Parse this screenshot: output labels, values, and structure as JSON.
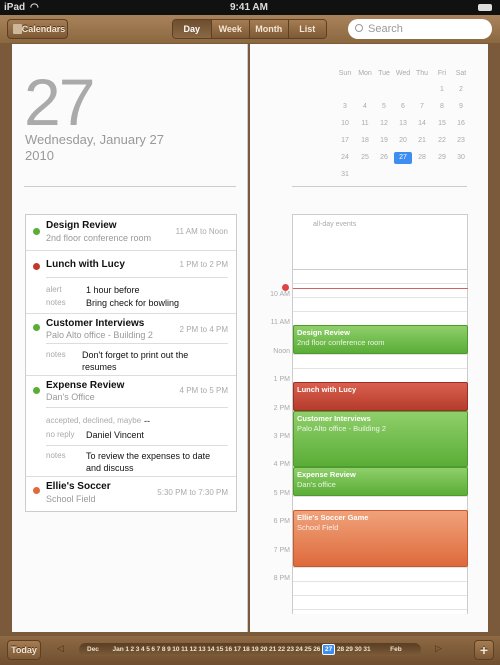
{
  "status": {
    "device": "iPad",
    "time": "9:41 AM"
  },
  "toolbar": {
    "calendars": "Calendars",
    "views": [
      "Day",
      "Week",
      "Month",
      "List"
    ],
    "selected_view": "Day",
    "search_placeholder": "Search"
  },
  "day": {
    "number": "27",
    "weekday_date": "Wednesday, January 27",
    "year": "2010"
  },
  "events": [
    {
      "title": "Design Review",
      "location": "2nd floor conference room",
      "time": "11 AM to Noon",
      "color": "#5aad37"
    },
    {
      "title": "Lunch with Lucy",
      "location": "",
      "time": "1 PM to 2 PM",
      "color": "#c0392b",
      "alert_label": "alert",
      "alert": "1 hour before",
      "notes_label": "notes",
      "notes": "Bring check for bowling"
    },
    {
      "title": "Customer Interviews",
      "location": "Palo Alto office - Building 2",
      "time": "2 PM to 4 PM",
      "color": "#5aad37",
      "notes_label": "notes",
      "notes": "Don't forget to print out the resumes"
    },
    {
      "title": "Expense Review",
      "location": "Dan's Office",
      "time": "4 PM to 5 PM",
      "color": "#5aad37",
      "attendees_label": "accepted, declined, maybe",
      "attendees": "--",
      "noreply_label": "no reply",
      "noreply": "Daniel Vincent",
      "notes_label": "notes",
      "notes": "To review the expenses to date and discuss"
    },
    {
      "title": "Ellie's Soccer",
      "location": "School Field",
      "time": "5:30 PM to 7:30 PM",
      "color": "#e06a3a"
    }
  ],
  "month": {
    "weekdays": [
      "Sun",
      "Mon",
      "Tue",
      "Wed",
      "Thu",
      "Fri",
      "Sat"
    ],
    "first_weekday": 5,
    "days": 31,
    "selected": 27
  },
  "timeline": {
    "allday": "all-day events",
    "hours": [
      "10 AM",
      "11 AM",
      "Noon",
      "1 PM",
      "2 PM",
      "3 PM",
      "4 PM",
      "5 PM",
      "6 PM",
      "7 PM",
      "8 PM"
    ],
    "blocks": [
      {
        "title": "Design Review",
        "sub": "2nd floor conference room",
        "start": 11,
        "end": 12,
        "cls": "green"
      },
      {
        "title": "Lunch with Lucy",
        "sub": "",
        "start": 13,
        "end": 14,
        "cls": "red"
      },
      {
        "title": "Customer Interviews",
        "sub": "Palo Alto office - Building 2",
        "start": 14,
        "end": 16,
        "cls": "green"
      },
      {
        "title": "Expense Review",
        "sub": "Dan's office",
        "start": 16,
        "end": 17,
        "cls": "green"
      },
      {
        "title": "Ellie's Soccer Game",
        "sub": "School Field",
        "start": 17.5,
        "end": 19.5,
        "cls": "orange"
      }
    ],
    "now": 9.68
  },
  "bottom": {
    "today": "Today",
    "prev_month": "Dec",
    "month": "Jan",
    "next_month": "Feb",
    "days": 31,
    "selected": 27,
    "add": "+"
  }
}
